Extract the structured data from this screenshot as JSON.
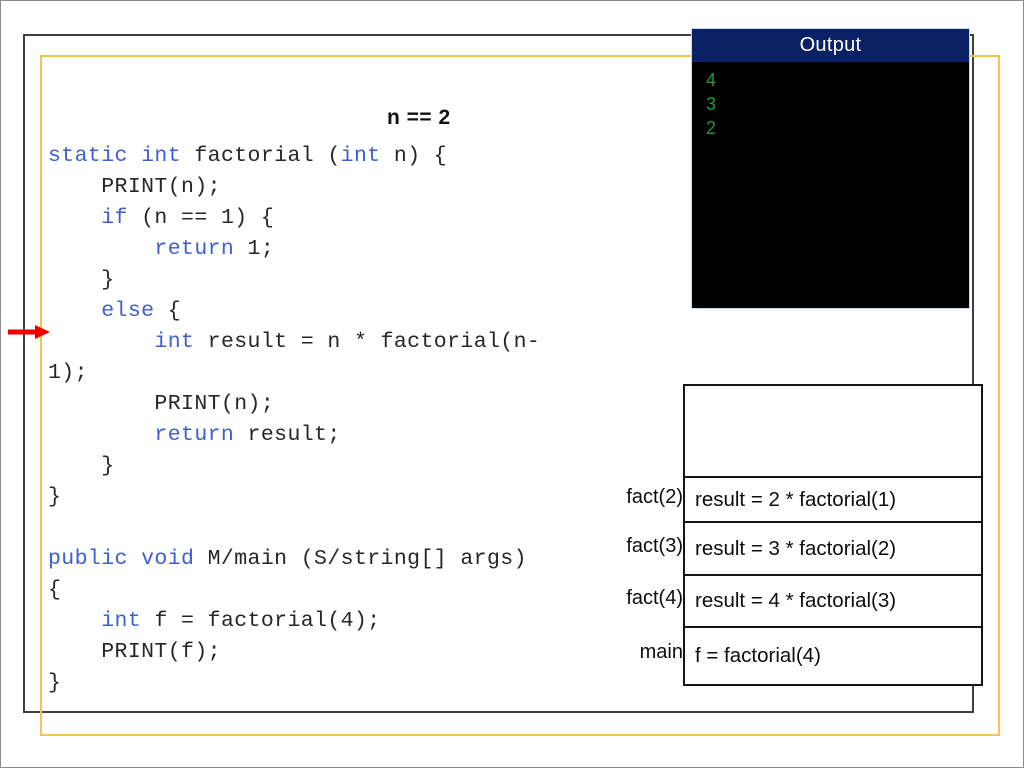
{
  "slide": {
    "annotation": "n == 2",
    "arrow_icon": "red-right-arrow-icon",
    "colors": {
      "keyword_blue": "#3d5fd0",
      "code_gray": "#262626",
      "frame_yellow": "#f5c44a",
      "frame_black": "#3f3f3f",
      "console_header": "#0a2265",
      "console_text_green": "#1f9b2f",
      "arrow_red": "#ee0000"
    }
  },
  "code": {
    "lines": [
      [
        {
          "t": "static int",
          "c": "kw"
        },
        {
          "t": " factorial (",
          "c": ""
        },
        {
          "t": "int",
          "c": "kw"
        },
        {
          "t": " n) {",
          "c": ""
        }
      ],
      [
        {
          "t": "    PRINT(n);",
          "c": ""
        }
      ],
      [
        {
          "t": "    ",
          "c": ""
        },
        {
          "t": "if",
          "c": "kw"
        },
        {
          "t": " (n == 1) {",
          "c": ""
        }
      ],
      [
        {
          "t": "        ",
          "c": ""
        },
        {
          "t": "return",
          "c": "kw"
        },
        {
          "t": " 1;",
          "c": ""
        }
      ],
      [
        {
          "t": "    }",
          "c": ""
        }
      ],
      [
        {
          "t": "    ",
          "c": ""
        },
        {
          "t": "else",
          "c": "kw"
        },
        {
          "t": " {",
          "c": ""
        }
      ],
      [
        {
          "t": "        ",
          "c": ""
        },
        {
          "t": "int",
          "c": "kw"
        },
        {
          "t": " result = n * factorial(n-",
          "c": ""
        }
      ],
      [
        {
          "t": "1);",
          "c": ""
        }
      ],
      [
        {
          "t": "        PRINT(n);",
          "c": ""
        }
      ],
      [
        {
          "t": "        ",
          "c": ""
        },
        {
          "t": "return",
          "c": "kw"
        },
        {
          "t": " result;",
          "c": ""
        }
      ],
      [
        {
          "t": "    }",
          "c": ""
        }
      ],
      [
        {
          "t": "}",
          "c": ""
        }
      ],
      [
        {
          "t": "",
          "c": ""
        }
      ],
      [
        {
          "t": "public void",
          "c": "kw"
        },
        {
          "t": " M/main (S/string[] args)",
          "c": ""
        }
      ],
      [
        {
          "t": "{",
          "c": ""
        }
      ],
      [
        {
          "t": "    ",
          "c": ""
        },
        {
          "t": "int",
          "c": "kw"
        },
        {
          "t": " f = factorial(4);",
          "c": ""
        }
      ],
      [
        {
          "t": "    PRINT(f);",
          "c": ""
        }
      ],
      [
        {
          "t": "}",
          "c": ""
        }
      ]
    ]
  },
  "console": {
    "title": "Output",
    "lines": [
      "4",
      "3",
      "2"
    ]
  },
  "call_stack": {
    "empty_top_cell": "",
    "frames": [
      {
        "label": "",
        "expression": "",
        "empty": true
      },
      {
        "label": "fact(2)",
        "expression": "result = 2 * factorial(1)"
      },
      {
        "label": "fact(3)",
        "expression": "result = 3 * factorial(2)"
      },
      {
        "label": "fact(4)",
        "expression": "result = 4 * factorial(3)"
      },
      {
        "label": "main",
        "expression": "f = factorial(4)"
      }
    ]
  }
}
